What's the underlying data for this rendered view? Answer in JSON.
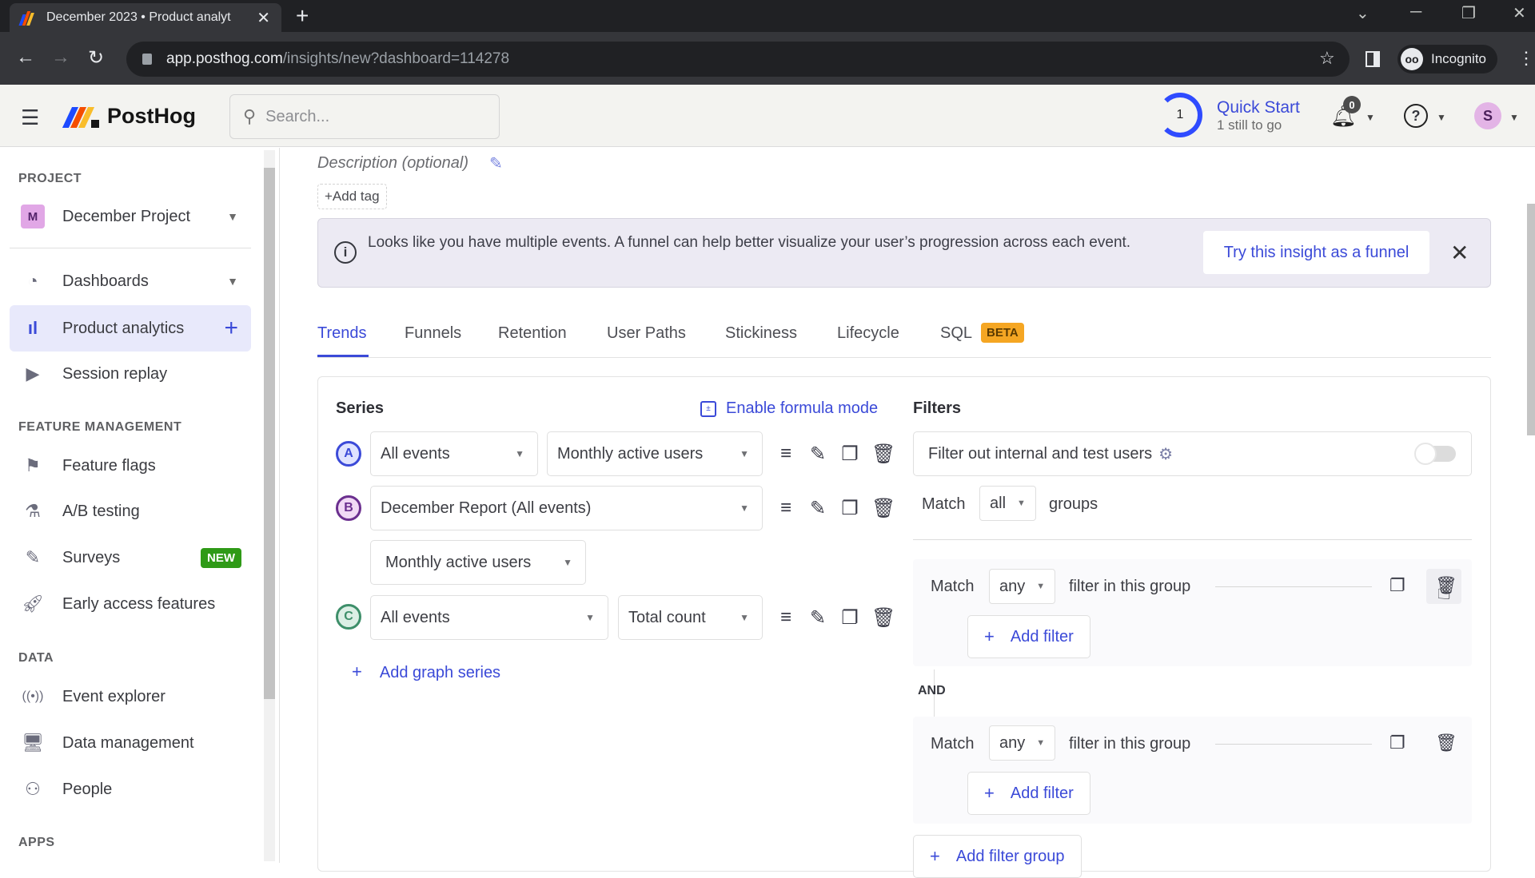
{
  "browser": {
    "tab_title": "December 2023 • Product analyt",
    "url_host": "app.posthog.com",
    "url_path": "/insights/new?dashboard=114278",
    "profile_label": "Incognito"
  },
  "header": {
    "brand": "PostHog",
    "search_placeholder": "Search...",
    "quick_start": {
      "title": "Quick Start",
      "subtitle": "1 still to go",
      "count": "1",
      "progress_fraction": 0.75
    },
    "notifications_count": "0",
    "avatar_initial": "S"
  },
  "sidebar": {
    "project_heading": "PROJECT",
    "project": {
      "initial": "M",
      "name": "December Project"
    },
    "items_top": [
      {
        "label": "Dashboards",
        "icon": "gauge-icon"
      },
      {
        "label": "Product analytics",
        "icon": "bar-chart-icon",
        "active": true
      },
      {
        "label": "Session replay",
        "icon": "play-square-icon"
      }
    ],
    "feature_heading": "FEATURE MANAGEMENT",
    "feature_items": [
      {
        "label": "Feature flags",
        "icon": "flag-icon"
      },
      {
        "label": "A/B testing",
        "icon": "flask-icon"
      },
      {
        "label": "Surveys",
        "icon": "survey-icon",
        "badge": "NEW"
      },
      {
        "label": "Early access features",
        "icon": "rocket-icon"
      }
    ],
    "data_heading": "DATA",
    "data_items": [
      {
        "label": "Event explorer",
        "icon": "broadcast-icon"
      },
      {
        "label": "Data management",
        "icon": "monitor-icon"
      },
      {
        "label": "People",
        "icon": "people-icon"
      }
    ],
    "apps_heading": "APPS"
  },
  "insight": {
    "description_placeholder": "Description (optional)",
    "add_tag": "+Add tag",
    "banner": {
      "text": "Looks like you have multiple events. A funnel can help better visualize your user’s progression across each event.",
      "action": "Try this insight as a funnel"
    },
    "tabs": [
      {
        "label": "Trends",
        "active": true
      },
      {
        "label": "Funnels"
      },
      {
        "label": "Retention"
      },
      {
        "label": "User Paths"
      },
      {
        "label": "Stickiness"
      },
      {
        "label": "Lifecycle"
      },
      {
        "label": "SQL",
        "badge": "BETA"
      }
    ]
  },
  "series": {
    "heading": "Series",
    "formula_mode": "Enable formula mode",
    "rows": [
      {
        "letter": "A",
        "event": "All events",
        "math": "Monthly active users"
      },
      {
        "letter": "B",
        "event": "December Report (All events)",
        "math": "Monthly active users"
      },
      {
        "letter": "C",
        "event": "All events",
        "math": "Total count"
      }
    ],
    "add_series": "Add graph series"
  },
  "filters": {
    "heading": "Filters",
    "internal_toggle_label": "Filter out internal and test users",
    "internal_toggle_on": false,
    "match_label": "Match",
    "match_value": "all",
    "groups_label": "groups",
    "groups": [
      {
        "match_label": "Match",
        "match_value": "any",
        "suffix": "filter in this group",
        "add_filter": "Add filter"
      },
      {
        "match_label": "Match",
        "match_value": "any",
        "suffix": "filter in this group",
        "add_filter": "Add filter"
      }
    ],
    "and_label": "AND",
    "add_group": "Add filter group"
  },
  "colors": {
    "accent": "#3b4ad8",
    "series_a": "#3b4ad8",
    "series_b": "#6b2f8f",
    "series_c": "#3e8f6a",
    "beta_badge": "#f5a623",
    "new_badge": "#2f9a17"
  }
}
